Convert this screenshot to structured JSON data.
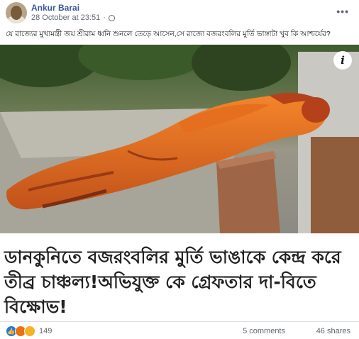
{
  "post": {
    "author": "Ankur Barai",
    "timestamp": "28 October at 23:51",
    "separator": "·",
    "more_icon": "more-horizontal-icon",
    "caption": "যে রাজ্যের মুখ্যমন্ত্রী জয় শ্রীরাম ধ্বনি শুনলে তেড়ে আসেন,সে রাজ্যে বজরংবলির মুর্তি ভাঙ্গাটা খুব কি আশ্চর্যের?"
  },
  "article": {
    "image_info_glyph": "i",
    "headline": "ডানকুনিতে বজরংবলির মুর্তি ভাঙাকে কেন্দ্র করে তীব্র চাঞ্চল্য!অভিযুক্ত কে গ্রেফতার দা-বিতে বিক্ষোভ!"
  },
  "engagement": {
    "reaction_icons": [
      "like-icon",
      "angry-icon",
      "sad-icon"
    ],
    "reaction_count": "149",
    "comments": "5 comments",
    "shares": "46 shares"
  }
}
